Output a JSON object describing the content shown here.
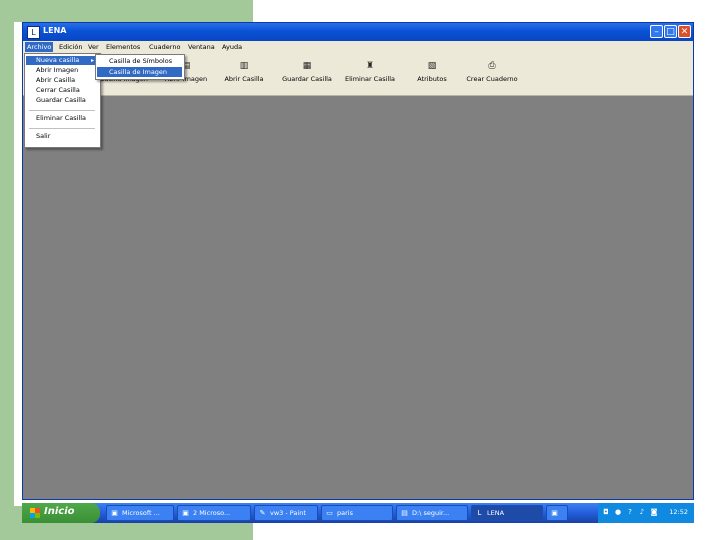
{
  "window": {
    "title": "LENA"
  },
  "menubar": {
    "items": [
      "Archivo",
      "Edición",
      "Ver",
      "Elementos",
      "Cuaderno",
      "Ventana",
      "Ayuda"
    ]
  },
  "toolbar": {
    "buttons": [
      "Casilla Imagen",
      "Abrir Imagen",
      "Abrir Casilla",
      "Guardar Casilla",
      "Eliminar Casilla",
      "Atributos",
      "Crear Cuaderno"
    ]
  },
  "archivo_menu": {
    "items": [
      "Nueva casilla",
      "Abrir Imagen",
      "Abrir Casilla",
      "Cerrar Casilla",
      "Guardar Casilla",
      "Eliminar Casilla",
      "Salir"
    ]
  },
  "nueva_submenu": {
    "items": [
      "Casilla de Símbolos",
      "Casilla de Imagen"
    ]
  },
  "taskbar": {
    "start_label": "Inicio",
    "tasks": [
      "Microsoft ...",
      "2 Microso...",
      "vw3 - Paint",
      "paris",
      "D:\\ seguir...",
      "LENA"
    ],
    "clock": "12:52"
  },
  "colors": {
    "accent": "#316ac5",
    "titlebar": "#0a52d6",
    "workspace": "#808080",
    "backdrop": "#a3c99a"
  }
}
